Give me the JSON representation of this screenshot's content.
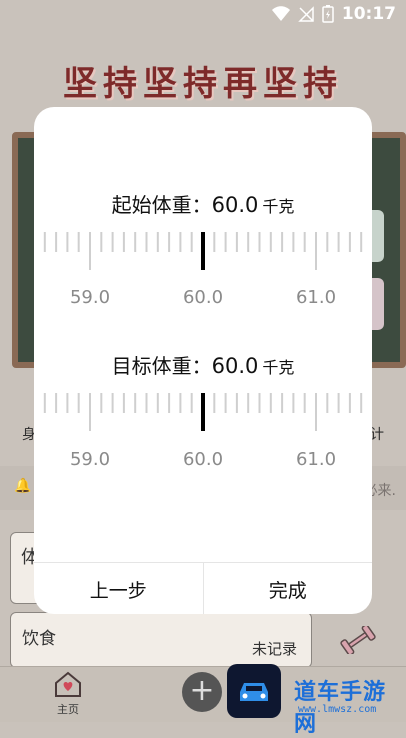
{
  "status_bar": {
    "time": "10:17",
    "icons": [
      "wifi-icon",
      "no-signal-icon",
      "battery-charging-icon"
    ]
  },
  "background": {
    "banner": "坚持坚持再坚持",
    "side_left": "身",
    "side_right": "计",
    "notice": "必来.",
    "card_partial": "体",
    "food_title": "饮食",
    "food_status": "未记录",
    "home_tab": "主页",
    "plus": "+",
    "watermark_text": "道车手游网",
    "watermark_url": "www.lmwsz.com"
  },
  "dialog": {
    "start_weight": {
      "title": "起始体重：",
      "value": "60.0",
      "unit": "千克",
      "ticks": [
        "59.0",
        "60.0",
        "61.0"
      ]
    },
    "target_weight": {
      "title": "目标体重：",
      "value": "60.0",
      "unit": "千克",
      "ticks": [
        "59.0",
        "60.0",
        "61.0"
      ]
    },
    "prev_button": "上一步",
    "done_button": "完成"
  }
}
